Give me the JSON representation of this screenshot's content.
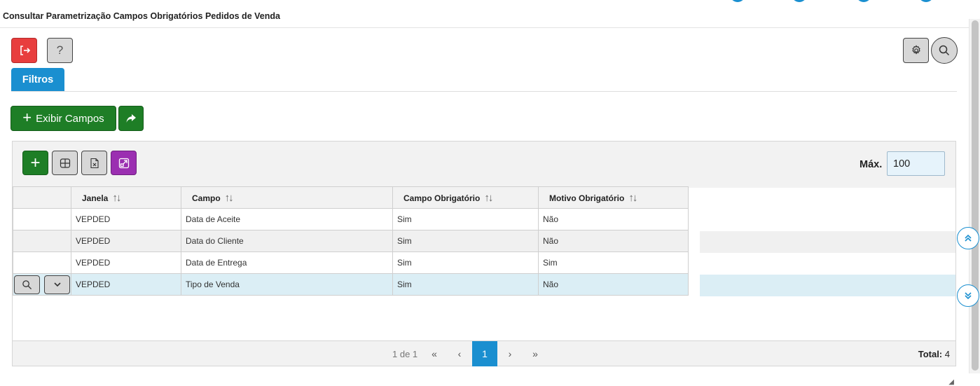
{
  "header": {
    "title": "Consultar Parametrização Campos Obrigatórios Pedidos de Venda"
  },
  "toolbar": {
    "exit_icon": "exit-icon",
    "help_label": "?",
    "gear_icon": "gear-icon",
    "search_icon": "search-icon"
  },
  "tabs": {
    "filtros": "Filtros"
  },
  "actions": {
    "exibir_campos": "Exibir Campos",
    "plus": "+"
  },
  "grid": {
    "max_label": "Máx.",
    "max_value": "100",
    "columns": [
      "Janela",
      "Campo",
      "Campo Obrigatório",
      "Motivo Obrigatório"
    ],
    "rows": [
      [
        "VEPDED",
        "Data de Aceite",
        "Sim",
        "Não"
      ],
      [
        "VEPDED",
        "Data do Cliente",
        "Sim",
        "Não"
      ],
      [
        "VEPDED",
        "Data de Entrega",
        "Sim",
        "Sim"
      ],
      [
        "VEPDED",
        "Tipo de Venda",
        "Sim",
        "Não"
      ]
    ],
    "add_label": "+"
  },
  "pagination": {
    "info": "1 de 1",
    "first": "«",
    "prev": "‹",
    "current": "1",
    "next": "›",
    "last": "»",
    "total_label": "Total:",
    "total_value": "4"
  },
  "colors": {
    "accent": "#1a8fd0",
    "success": "#1e7e26",
    "danger": "#e83e3e",
    "purple": "#9b2fb1"
  }
}
